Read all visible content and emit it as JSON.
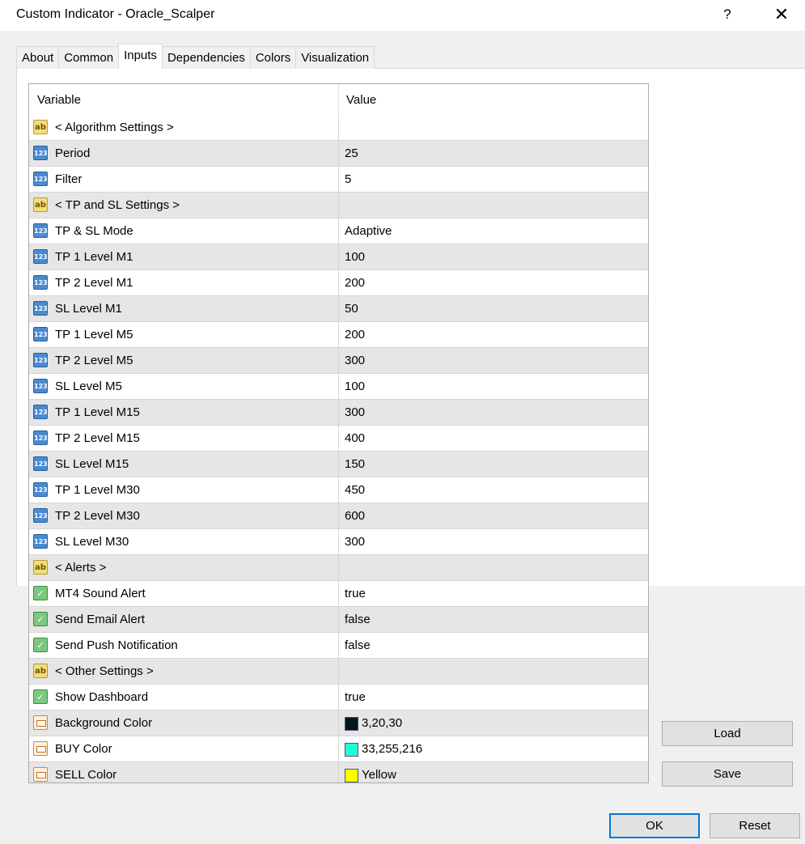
{
  "window": {
    "title": "Custom Indicator - Oracle_Scalper",
    "help_glyph": "?",
    "close_glyph": "✕"
  },
  "tabs": [
    "About",
    "Common",
    "Inputs",
    "Dependencies",
    "Colors",
    "Visualization"
  ],
  "active_tab": "Inputs",
  "table": {
    "headers": {
      "variable": "Variable",
      "value": "Value"
    },
    "rows": [
      {
        "type": "ab",
        "icon": "string-icon",
        "name": "< Algorithm Settings >",
        "value": ""
      },
      {
        "type": "num",
        "icon": "integer-icon",
        "name": "Period",
        "value": "25"
      },
      {
        "type": "num",
        "icon": "integer-icon",
        "name": "Filter",
        "value": "5"
      },
      {
        "type": "ab",
        "icon": "string-icon",
        "name": "< TP and SL Settings >",
        "value": ""
      },
      {
        "type": "num",
        "icon": "integer-icon",
        "name": "TP & SL Mode",
        "value": "Adaptive"
      },
      {
        "type": "num",
        "icon": "integer-icon",
        "name": "TP 1 Level M1",
        "value": "100"
      },
      {
        "type": "num",
        "icon": "integer-icon",
        "name": "TP 2 Level M1",
        "value": "200"
      },
      {
        "type": "num",
        "icon": "integer-icon",
        "name": "SL Level M1",
        "value": "50"
      },
      {
        "type": "num",
        "icon": "integer-icon",
        "name": "TP 1 Level M5",
        "value": "200"
      },
      {
        "type": "num",
        "icon": "integer-icon",
        "name": "TP 2 Level M5",
        "value": "300"
      },
      {
        "type": "num",
        "icon": "integer-icon",
        "name": "SL Level M5",
        "value": "100"
      },
      {
        "type": "num",
        "icon": "integer-icon",
        "name": "TP 1 Level M15",
        "value": "300"
      },
      {
        "type": "num",
        "icon": "integer-icon",
        "name": "TP 2 Level M15",
        "value": "400"
      },
      {
        "type": "num",
        "icon": "integer-icon",
        "name": "SL Level M15",
        "value": "150"
      },
      {
        "type": "num",
        "icon": "integer-icon",
        "name": "TP 1 Level M30",
        "value": "450"
      },
      {
        "type": "num",
        "icon": "integer-icon",
        "name": "TP 2 Level M30",
        "value": "600"
      },
      {
        "type": "num",
        "icon": "integer-icon",
        "name": "SL Level M30",
        "value": "300"
      },
      {
        "type": "ab",
        "icon": "string-icon",
        "name": "< Alerts >",
        "value": ""
      },
      {
        "type": "bool",
        "icon": "boolean-icon",
        "name": "MT4 Sound Alert",
        "value": "true"
      },
      {
        "type": "bool",
        "icon": "boolean-icon",
        "name": "Send Email Alert",
        "value": "false"
      },
      {
        "type": "bool",
        "icon": "boolean-icon",
        "name": "Send Push Notification",
        "value": "false"
      },
      {
        "type": "ab",
        "icon": "string-icon",
        "name": "< Other Settings >",
        "value": ""
      },
      {
        "type": "bool",
        "icon": "boolean-icon",
        "name": "Show Dashboard",
        "value": "true"
      },
      {
        "type": "color",
        "icon": "color-icon",
        "name": "Background Color",
        "value": "3,20,30",
        "swatch": "#03141e"
      },
      {
        "type": "color",
        "icon": "color-icon",
        "name": "BUY Color",
        "value": "33,255,216",
        "swatch": "#21ffd8"
      },
      {
        "type": "color",
        "icon": "color-icon",
        "name": "SELL Color",
        "value": "Yellow",
        "swatch": "#ffff00"
      }
    ]
  },
  "buttons": {
    "load": "Load",
    "save": "Save",
    "ok": "OK",
    "reset": "Reset"
  }
}
